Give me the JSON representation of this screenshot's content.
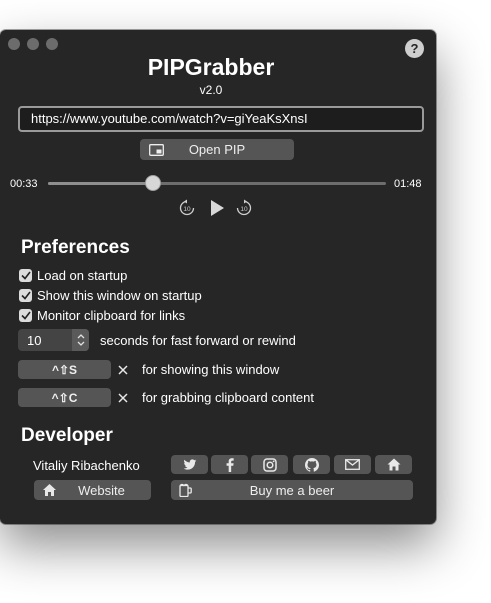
{
  "app": {
    "title": "PIPGrabber",
    "version": "v2.0"
  },
  "url_field": {
    "value": "https://www.youtube.com/watch?v=giYeaKsXnsI"
  },
  "open_pip_button": {
    "label": "Open PIP"
  },
  "player": {
    "elapsed": "00:33",
    "duration": "01:48",
    "progress": 0.31
  },
  "preferences": {
    "heading": "Preferences",
    "checkboxes": [
      {
        "label": "Load on startup",
        "checked": true
      },
      {
        "label": "Show this window on startup",
        "checked": true
      },
      {
        "label": "Monitor clipboard for links",
        "checked": true
      }
    ],
    "seek_seconds": {
      "value": "10",
      "label": "seconds for fast forward or rewind"
    },
    "shortcuts": [
      {
        "keys": "^⇧S",
        "label": "for showing this window"
      },
      {
        "keys": "^⇧C",
        "label": "for grabbing clipboard content"
      }
    ]
  },
  "developer": {
    "heading": "Developer",
    "name": "Vitaliy Ribachenko",
    "social_icons": [
      "twitter-icon",
      "facebook-icon",
      "instagram-icon",
      "github-icon",
      "mail-icon",
      "home-icon"
    ],
    "website_button": {
      "label": "Website"
    },
    "beer_button": {
      "label": "Buy me a beer"
    }
  },
  "colors": {
    "window_bg": "#262626",
    "button_bg": "#555555",
    "field_border": "#9a9a9a"
  }
}
